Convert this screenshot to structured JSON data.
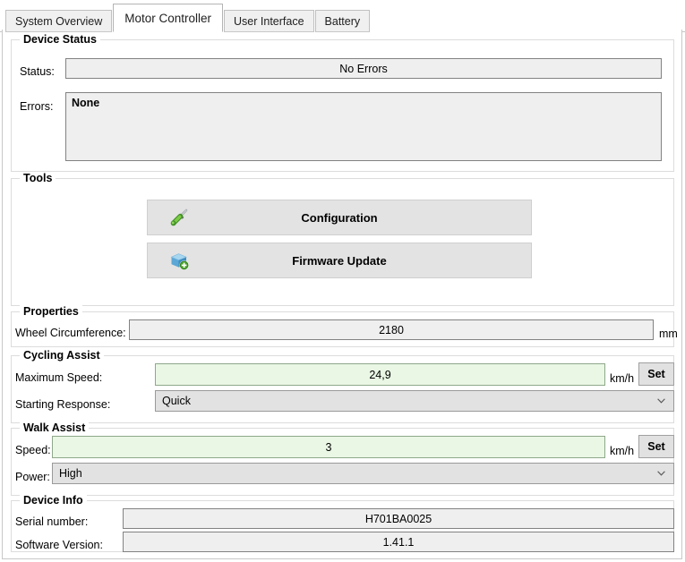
{
  "tabs": [
    {
      "label": "System Overview",
      "active": false
    },
    {
      "label": "Motor Controller",
      "active": true
    },
    {
      "label": "User Interface",
      "active": false
    },
    {
      "label": "Battery",
      "active": false
    }
  ],
  "device_status": {
    "legend": "Device Status",
    "status_label": "Status:",
    "status_value": "No Errors",
    "errors_label": "Errors:",
    "errors_value": "None"
  },
  "tools": {
    "legend": "Tools",
    "buttons": [
      {
        "label": "Configuration",
        "icon": "screwdriver-icon"
      },
      {
        "label": "Firmware Update",
        "icon": "package-update-icon"
      }
    ]
  },
  "properties": {
    "legend": "Properties",
    "wheel_circumference_label": "Wheel Circumference:",
    "wheel_circumference_value": "2180",
    "wheel_circumference_unit": "mm"
  },
  "cycling_assist": {
    "legend": "Cycling Assist",
    "max_speed_label": "Maximum Speed:",
    "max_speed_value": "24,9",
    "max_speed_unit": "km/h",
    "max_speed_set": "Set",
    "starting_response_label": "Starting Response:",
    "starting_response_value": "Quick"
  },
  "walk_assist": {
    "legend": "Walk Assist",
    "speed_label": "Speed:",
    "speed_value": "3",
    "speed_unit": "km/h",
    "speed_set": "Set",
    "power_label": "Power:",
    "power_value": "High"
  },
  "device_info": {
    "legend": "Device Info",
    "serial_label": "Serial number:",
    "serial_value": "H701BA0025",
    "software_label": "Software Version:",
    "software_value": "1.41.1"
  },
  "colors": {
    "accent_green_bg": "#e9f7e4",
    "accent_green_border": "#8fa88a",
    "field_bg": "#efefef",
    "field_border": "#828282",
    "panel_border": "#c8c8c8"
  }
}
